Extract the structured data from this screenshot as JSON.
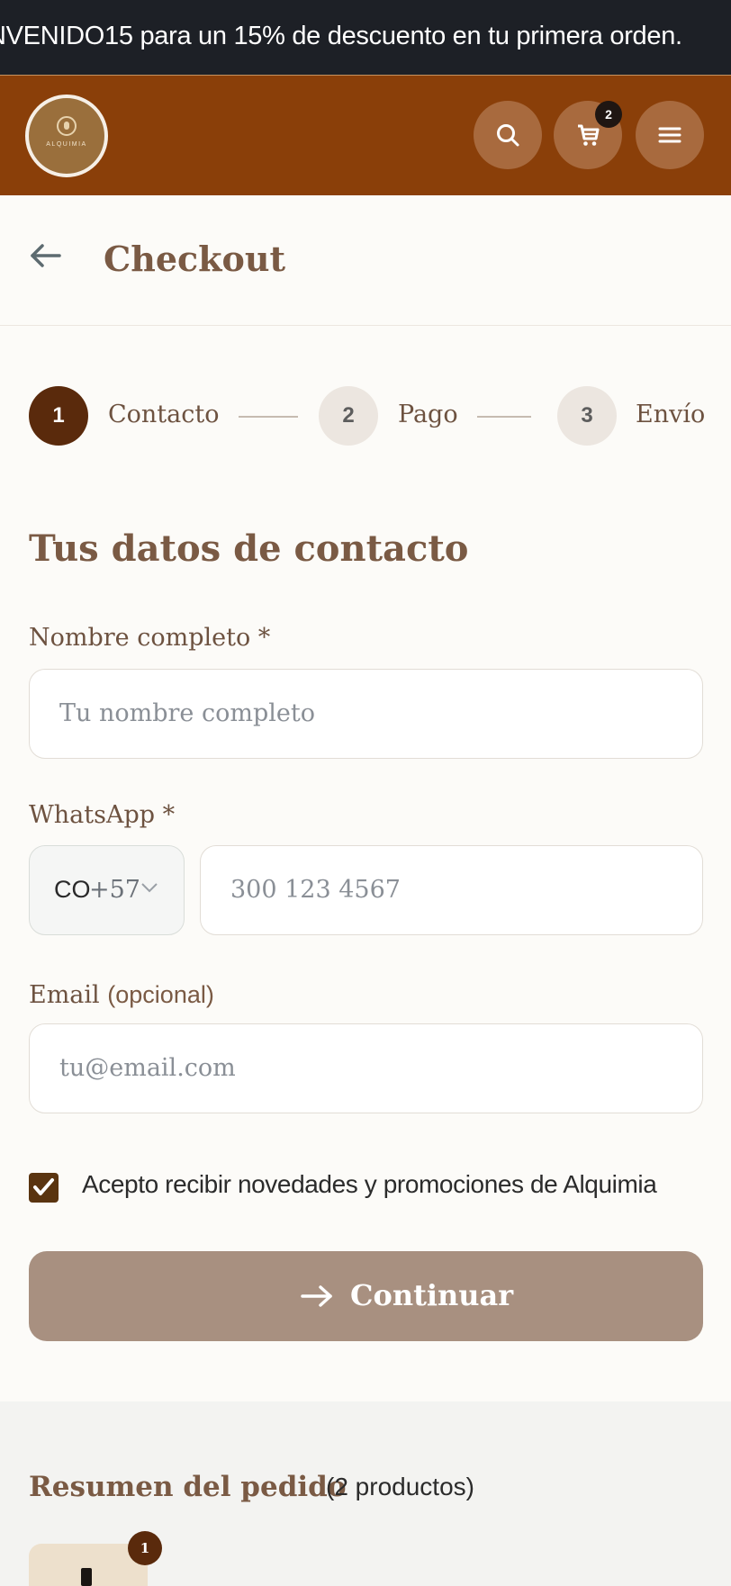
{
  "announcement": {
    "text": "NVENIDO15 para un 15% de descuento en tu primera orden."
  },
  "header": {
    "logo_text": "ALQUIMIA",
    "cart_count": "2",
    "icons": {
      "search": "search-icon",
      "cart": "cart-icon",
      "menu": "menu-icon"
    },
    "colors": {
      "bar": "#8a3f09",
      "button": "#a86a3e"
    }
  },
  "page": {
    "title": "Checkout",
    "back_icon": "arrow-left-icon"
  },
  "steps": [
    {
      "number": "1",
      "label": "Contacto",
      "active": true
    },
    {
      "number": "2",
      "label": "Pago",
      "active": false
    },
    {
      "number": "3",
      "label": "Envío",
      "active": false
    }
  ],
  "form": {
    "title": "Tus datos de contacto",
    "name": {
      "label": "Nombre completo *",
      "placeholder": "Tu nombre completo",
      "value": ""
    },
    "whatsapp": {
      "label": "WhatsApp *",
      "country_code": "CO",
      "dial_code": "+57",
      "placeholder": "300 123 4567",
      "value": ""
    },
    "email": {
      "label": "Email",
      "optional": "(opcional)",
      "placeholder": "tu@email.com",
      "value": ""
    },
    "newsletter": {
      "label": "Acepto recibir novedades y promociones de Alquimia",
      "checked": true
    },
    "submit": {
      "label": "Continuar",
      "icon": "arrow-right-icon"
    }
  },
  "summary": {
    "title": "Resumen del pedido",
    "count": "(2 productos)",
    "items": [
      {
        "quantity": "1"
      }
    ]
  },
  "colors": {
    "accent": "#5a3410",
    "heading": "#7a5a44",
    "button": "#a89080"
  }
}
